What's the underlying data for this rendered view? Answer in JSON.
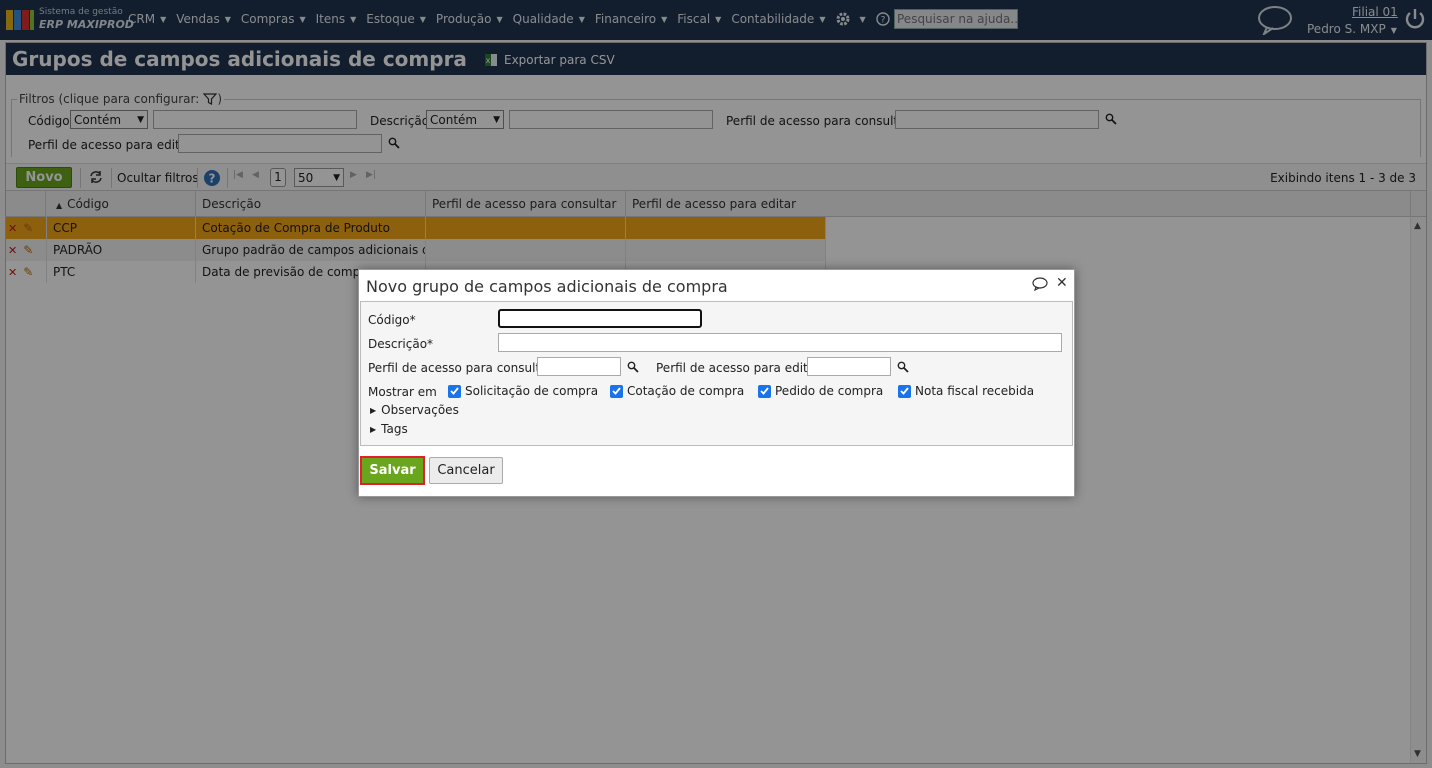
{
  "app": {
    "logo_line1": "Sistema de gestão",
    "logo_line2": "ERP MAXIPROD",
    "branch": "Filial 01",
    "user": "Pedro S. MXP"
  },
  "menu": [
    "CRM",
    "Vendas",
    "Compras",
    "Itens",
    "Estoque",
    "Produção",
    "Qualidade",
    "Financeiro",
    "Fiscal",
    "Contabilidade"
  ],
  "help_search": {
    "placeholder": "Pesquisar na ajuda..."
  },
  "page": {
    "title": "Grupos de campos adicionais de compra",
    "export": "Exportar para CSV"
  },
  "filters": {
    "legend": "Filtros (clique para configurar:",
    "legend_end": ")",
    "code_label": "Código",
    "code_op": "Contém",
    "desc_label": "Descrição",
    "desc_op": "Contém",
    "view_profile_label": "Perfil de acesso para consultar",
    "edit_profile_label": "Perfil de acesso para editar"
  },
  "toolbar": {
    "new": "Novo",
    "hide_filters": "Ocultar filtros",
    "page": "1",
    "page_size": "50",
    "showing": "Exibindo itens 1 - 3 de 3"
  },
  "grid": {
    "columns": [
      "Código",
      "Descrição",
      "Perfil de acesso para consultar",
      "Perfil de acesso para editar"
    ],
    "rows": [
      {
        "code": "CCP",
        "desc": "Cotação de Compra de Produto"
      },
      {
        "code": "PADRÃO",
        "desc": "Grupo padrão de campos adicionais d..."
      },
      {
        "code": "PTC",
        "desc": "Data de previsão de compra"
      }
    ]
  },
  "dialog": {
    "title": "Novo grupo de campos adicionais de compra",
    "code_label": "Código*",
    "desc_label": "Descrição*",
    "view_profile_label": "Perfil de acesso para consultar",
    "edit_profile_label": "Perfil de acesso para editar",
    "show_in_label": "Mostrar em",
    "checkboxes": [
      "Solicitação de compra",
      "Cotação de compra",
      "Pedido de compra",
      "Nota fiscal recebida"
    ],
    "notes": "Observações",
    "tags": "Tags",
    "save": "Salvar",
    "cancel": "Cancelar"
  },
  "colors": {
    "brand": "#1f3550",
    "accent_green": "#6aa51e",
    "selected_row": "#f2a516",
    "save_outline": "#e0202a",
    "checkbox": "#1a73e8"
  }
}
